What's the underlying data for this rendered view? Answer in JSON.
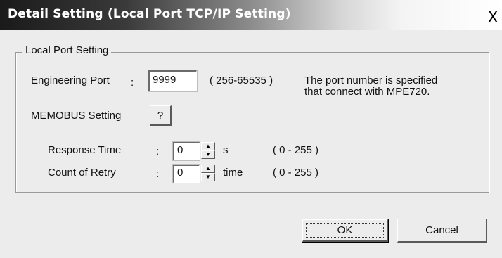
{
  "dialog": {
    "title": "Detail Setting (Local Port TCP/IP Setting)",
    "close_glyph": "X"
  },
  "group": {
    "legend": "Local Port Setting",
    "engineering_port": {
      "label": "Engineering Port",
      "colon": ":",
      "value": "9999",
      "range": "( 256-65535 )",
      "note_line1": "The port number is specified",
      "note_line2": "that connect with MPE720."
    },
    "memobus": {
      "label": "MEMOBUS Setting",
      "button_label": "?"
    },
    "response_time": {
      "label": "Response Time",
      "colon": ":",
      "value": "0",
      "unit": "s",
      "range": "( 0 - 255 )"
    },
    "retry_count": {
      "label": "Count of Retry",
      "colon": ":",
      "value": "0",
      "unit": "time",
      "range": "( 0 - 255 )"
    }
  },
  "buttons": {
    "ok_label": "OK",
    "cancel_label": "Cancel"
  },
  "icons": {
    "spin_up": "up-arrow-icon",
    "spin_down": "down-arrow-icon"
  }
}
